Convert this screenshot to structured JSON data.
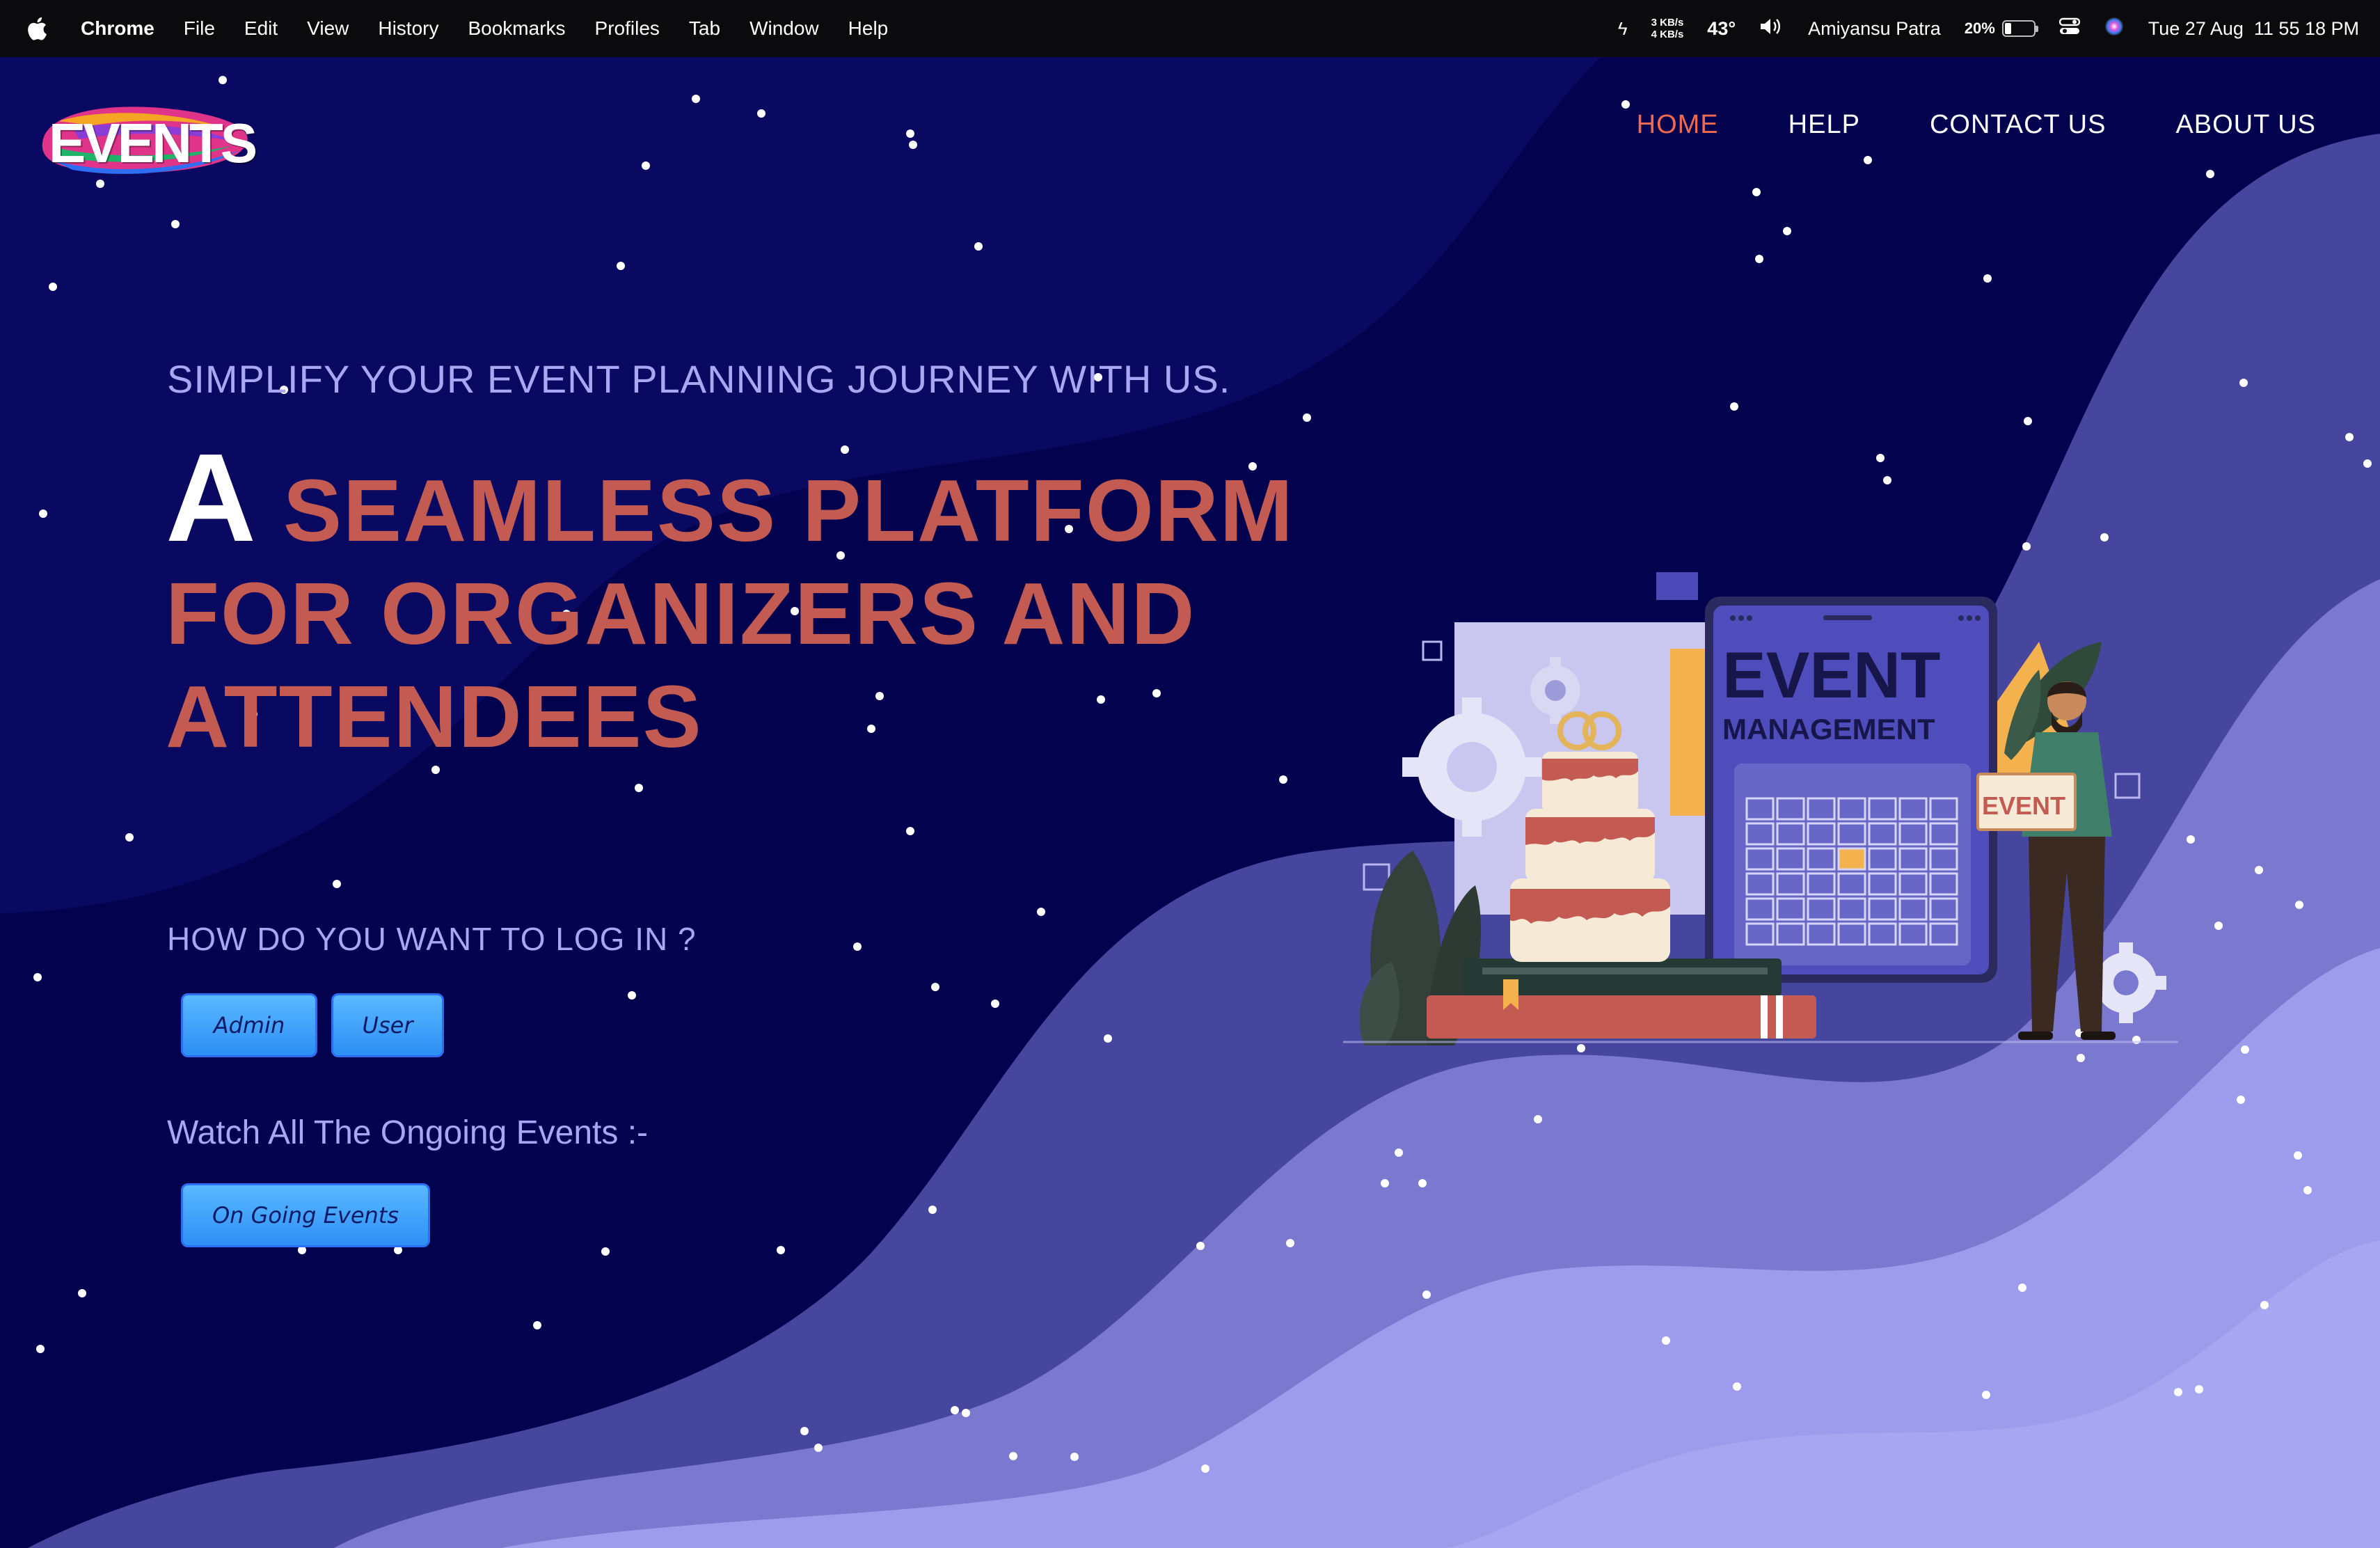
{
  "menubar": {
    "app_name": "Chrome",
    "menus": [
      "File",
      "Edit",
      "View",
      "History",
      "Bookmarks",
      "Profiles",
      "Tab",
      "Window",
      "Help"
    ],
    "net_up": "3 KB/s",
    "net_down": "4 KB/s",
    "temperature": "43°",
    "user": "Amiyansu Patra",
    "battery_percent": "20%",
    "battery_level": 0.2,
    "datetime": "Tue 27 Aug  11 55 18 PM"
  },
  "logo": {
    "text": "EVENTS"
  },
  "nav": {
    "items": [
      {
        "label": "HOME",
        "active": true
      },
      {
        "label": "HELP",
        "active": false
      },
      {
        "label": "CONTACT US",
        "active": false
      },
      {
        "label": "ABOUT US",
        "active": false
      }
    ]
  },
  "hero": {
    "tagline": "SIMPLIFY YOUR EVENT PLANNING JOURNEY WITH US.",
    "headline_a": "A",
    "headline_rest": "SEAMLESS PLATFORM FOR ORGANIZERS AND ATTENDEES",
    "login_question": "HOW DO YOU WANT TO LOG IN ?",
    "admin_button": "Admin",
    "user_button": "User",
    "watch_label": "Watch All The Ongoing Events :-",
    "ongoing_button": "On Going Events"
  },
  "illustration": {
    "laptop_title": "EVENT",
    "laptop_subtitle": "MANAGEMENT",
    "sign_text": "EVENT"
  },
  "colors": {
    "background": "#03024f",
    "accent_heading": "#c45b52",
    "nav_active": "#f06a4f",
    "soft_text": "#a9a6f3",
    "button": "#3a9cf7"
  }
}
